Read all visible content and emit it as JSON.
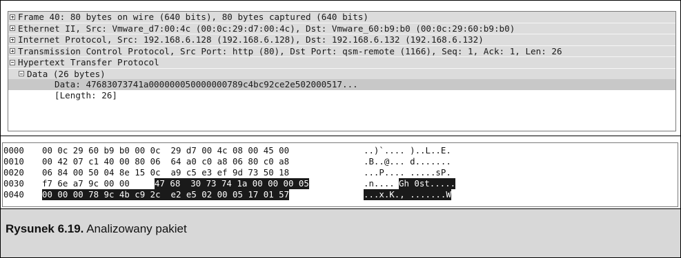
{
  "packet_details": {
    "rows": [
      {
        "text": "Frame 40: 80 bytes on wire (640 bits), 80 bytes captured (640 bits)",
        "expander": "plus",
        "indent": 0
      },
      {
        "text": "Ethernet II, Src: Vmware_d7:00:4c (00:0c:29:d7:00:4c), Dst: Vmware_60:b9:b0 (00:0c:29:60:b9:b0)",
        "expander": "plus",
        "indent": 0
      },
      {
        "text": "Internet Protocol, Src: 192.168.6.128 (192.168.6.128), Dst: 192.168.6.132 (192.168.6.132)",
        "expander": "plus",
        "indent": 0
      },
      {
        "text": "Transmission Control Protocol, Src Port: http (80), Dst Port: qsm-remote (1166), Seq: 1, Ack: 1, Len: 26",
        "expander": "plus",
        "indent": 0
      },
      {
        "text": "Hypertext Transfer Protocol",
        "expander": "minus",
        "indent": 0
      },
      {
        "text": "Data (26 bytes)",
        "expander": "minus",
        "indent": 1
      },
      {
        "text": "Data: 47683073741a000000050000000789c4bc92ce2e502000517...",
        "expander": "none",
        "indent": 2
      },
      {
        "text": "[Length: 26]",
        "expander": "none",
        "indent": 2
      }
    ]
  },
  "hex_dump": {
    "lines": [
      {
        "offset": "0000",
        "hex_normal": "00 0c 29 60 b9 b0 00 0c  29 d7 00 4c 08 00 45 00",
        "hex_highlight": "",
        "ascii_normal": "..)`.... )..L..E.",
        "ascii_highlight": ""
      },
      {
        "offset": "0010",
        "hex_normal": "00 42 07 c1 40 00 80 06  64 a0 c0 a8 06 80 c0 a8",
        "hex_highlight": "",
        "ascii_normal": ".B..@... d.......",
        "ascii_highlight": ""
      },
      {
        "offset": "0020",
        "hex_normal": "06 84 00 50 04 8e 15 0c  a9 c5 e3 ef 9d 73 50 18",
        "hex_highlight": "",
        "ascii_normal": "...P.... .....sP.",
        "ascii_highlight": ""
      },
      {
        "offset": "0030",
        "hex_normal": "f7 6e a7 9c 00 00 ",
        "hex_highlight": "47 68  30 73 74 1a 00 00 00 05",
        "ascii_normal": ".n....",
        "ascii_highlight": "Gh 0st....."
      },
      {
        "offset": "0040",
        "hex_normal": "",
        "hex_highlight": "00 00 00 78 9c 4b c9 2c  e2 e5 02 00 05 17 01 57",
        "ascii_normal": "",
        "ascii_highlight": "...x.K., .......W"
      }
    ]
  },
  "caption": {
    "label": "Rysunek 6.19.",
    "text": "Analizowany pakiet"
  },
  "colors": {
    "shaded_row": "#dcdcdc",
    "selected_row": "#c8c8c8",
    "highlight_bg": "#1a1a1a",
    "highlight_fg": "#ffffff",
    "caption_bg": "#d8d8d8"
  }
}
